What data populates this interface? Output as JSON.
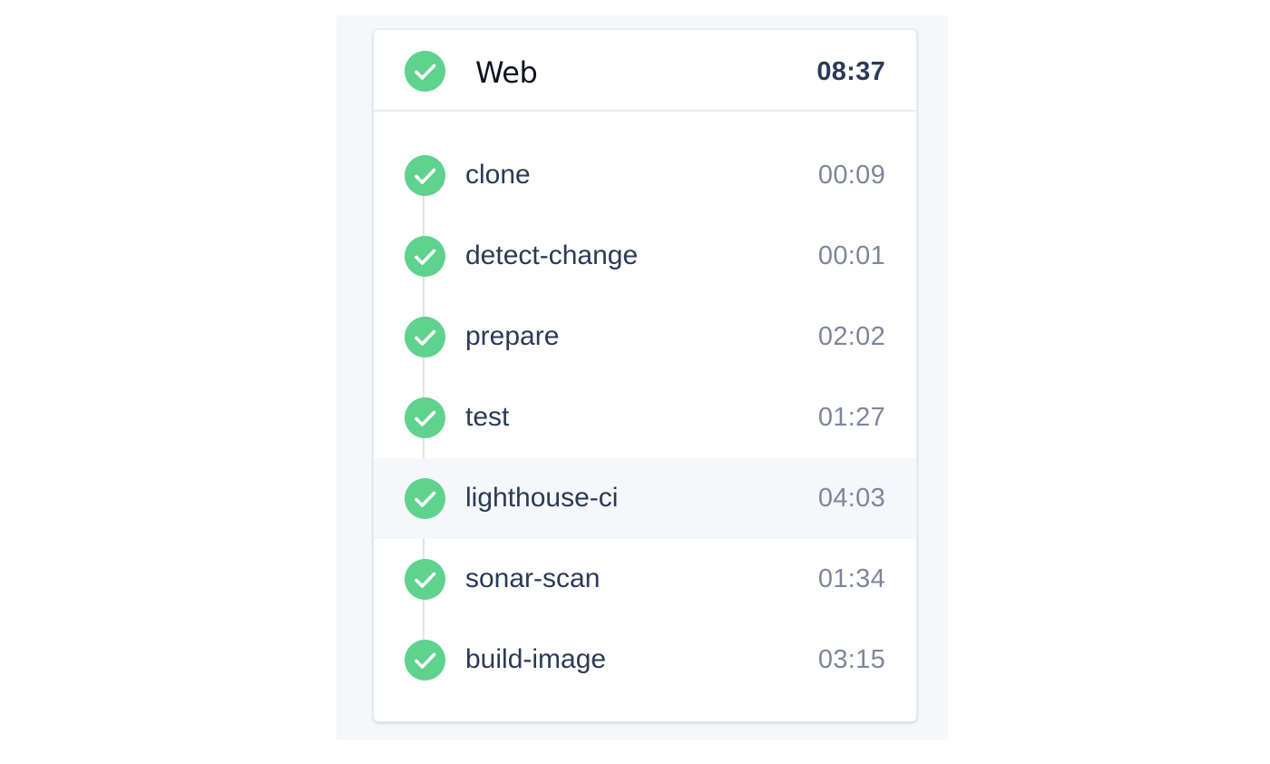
{
  "pipeline": {
    "title": "Web",
    "duration": "08:37",
    "status_icon": "check-circle-icon",
    "status_color": "#5fd28e"
  },
  "steps": [
    {
      "name": "clone",
      "duration": "00:09",
      "status_icon": "check-circle-icon"
    },
    {
      "name": "detect-change",
      "duration": "00:01",
      "status_icon": "check-circle-icon"
    },
    {
      "name": "prepare",
      "duration": "02:02",
      "status_icon": "check-circle-icon"
    },
    {
      "name": "test",
      "duration": "01:27",
      "status_icon": "check-circle-icon"
    },
    {
      "name": "lighthouse-ci",
      "duration": "04:03",
      "status_icon": "check-circle-icon",
      "highlighted": true
    },
    {
      "name": "sonar-scan",
      "duration": "01:34",
      "status_icon": "check-circle-icon"
    },
    {
      "name": "build-image",
      "duration": "03:15",
      "status_icon": "check-circle-icon"
    }
  ],
  "colors": {
    "success": "#5fd28e",
    "text_primary": "#2b3a55",
    "text_muted": "#7d8799",
    "highlight_bg": "#f5f7fa"
  }
}
